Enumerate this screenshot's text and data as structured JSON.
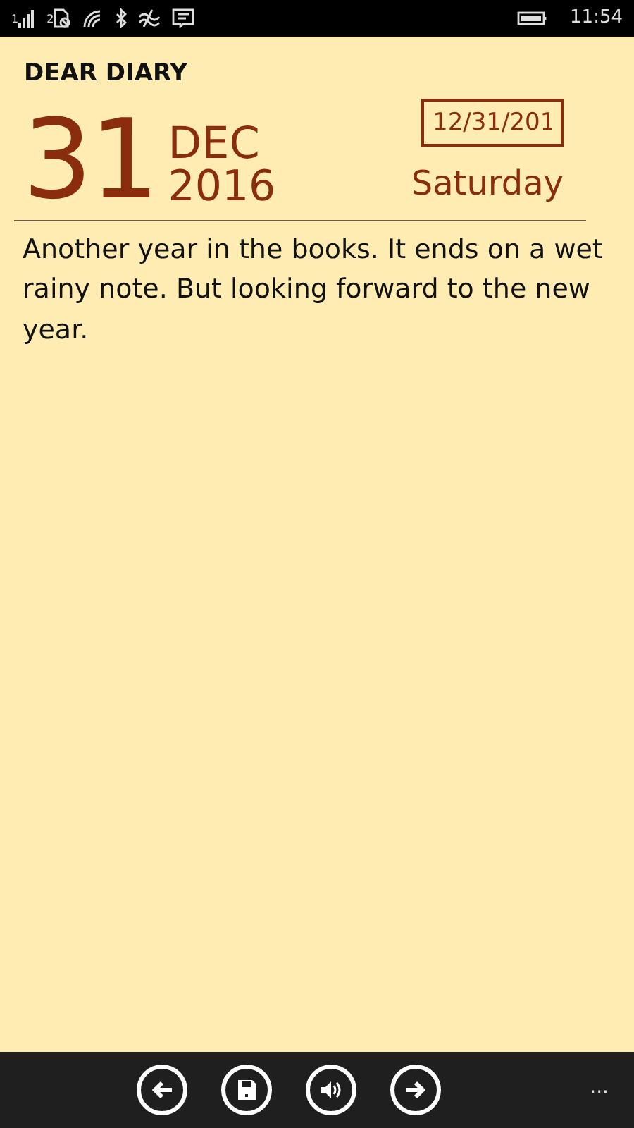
{
  "status_bar": {
    "sim_1": "1",
    "sim_2": "2",
    "time": "11:54"
  },
  "app_title": "DEAR DIARY",
  "date": {
    "day": "31",
    "month": "DEC",
    "year": "2016",
    "field_value": "12/31/201",
    "weekday": "Saturday"
  },
  "entry": "Another year in the books. It ends on a wet rainy note. But looking forward to the new year.",
  "app_bar": {
    "buttons": [
      {
        "kind": "back"
      },
      {
        "kind": "save"
      },
      {
        "kind": "speak"
      },
      {
        "kind": "forward"
      }
    ],
    "more": "..."
  }
}
